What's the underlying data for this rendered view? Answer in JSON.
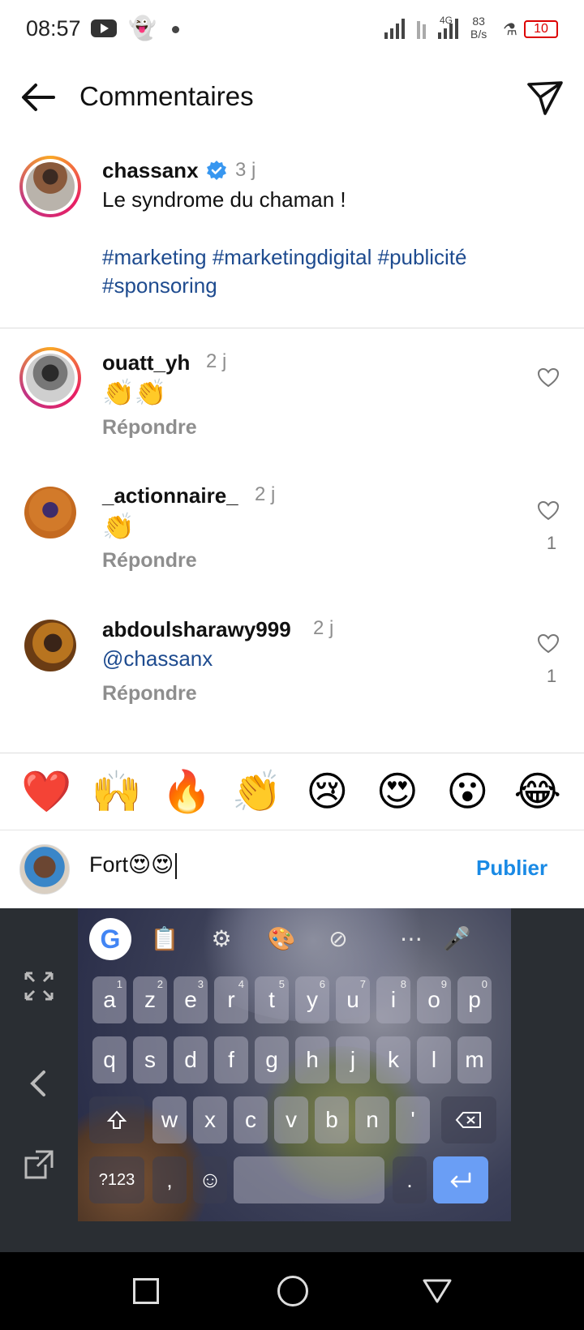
{
  "status_bar": {
    "time": "08:57",
    "net_type": "4G",
    "speed_value": "83",
    "speed_unit": "B/s",
    "battery": "10"
  },
  "header": {
    "title": "Commentaires"
  },
  "post": {
    "username": "chassanx",
    "verified": true,
    "time": "3 j",
    "text": "Le syndrome du chaman !",
    "hashtags": "#marketing #marketingdigital #publicité #sponsoring"
  },
  "comments": [
    {
      "username": "ouatt_yh",
      "time": "2 j",
      "text": "👏👏",
      "reply_label": "Répondre",
      "likes": ""
    },
    {
      "username": "_actionnaire_",
      "time": "2 j",
      "text": "👏",
      "reply_label": "Répondre",
      "likes": "1"
    },
    {
      "username": "abdoulsharawy999",
      "time": "2 j",
      "text": "@chassanx",
      "reply_label": "Répondre",
      "likes": "1"
    }
  ],
  "emoji_bar": [
    "❤️",
    "🙌",
    "🔥",
    "👏",
    "😢",
    "😍",
    "😮",
    "😂"
  ],
  "composer": {
    "value": "Fort😍😍",
    "publish_label": "Publier"
  },
  "keyboard": {
    "row1": [
      "a",
      "z",
      "e",
      "r",
      "t",
      "y",
      "u",
      "i",
      "o",
      "p"
    ],
    "row1_digits": [
      "1",
      "2",
      "3",
      "4",
      "5",
      "6",
      "7",
      "8",
      "9",
      "0"
    ],
    "row2": [
      "q",
      "s",
      "d",
      "f",
      "g",
      "h",
      "j",
      "k",
      "l",
      "m"
    ],
    "row3": [
      "w",
      "x",
      "c",
      "v",
      "b",
      "n",
      "'"
    ],
    "symbols_label": "?123",
    "comma": ",",
    "period": "."
  },
  "colors": {
    "accent": "#1a8ae5",
    "hashtag": "#1e4b8f",
    "verified": "#3897f0",
    "enter_key": "#6a9ef5"
  }
}
